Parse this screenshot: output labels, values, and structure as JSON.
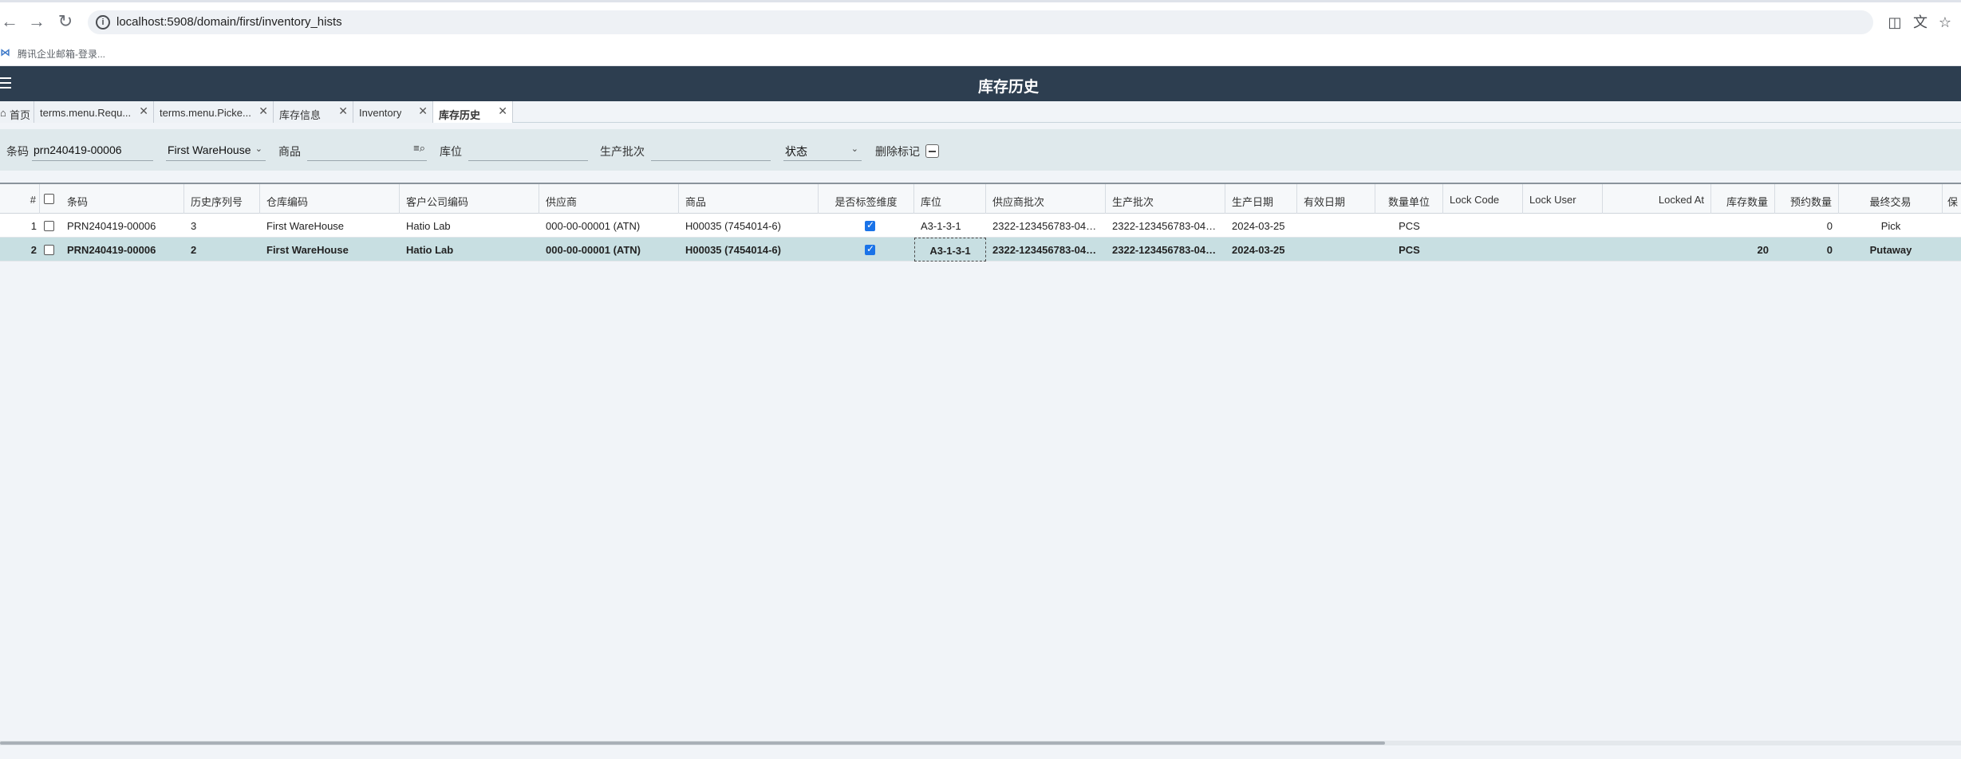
{
  "browser": {
    "url": "localhost:5908/domain/first/inventory_hists",
    "bookmark": "腾讯企业邮箱-登录..."
  },
  "app": {
    "title": "库存历史"
  },
  "tabs": [
    {
      "label": "首页",
      "icon": "home-icon"
    },
    {
      "label": "terms.menu.Requ..."
    },
    {
      "label": "terms.menu.Picke..."
    },
    {
      "label": "库存信息"
    },
    {
      "label": "Inventory"
    },
    {
      "label": "库存历史",
      "active": true
    }
  ],
  "filters": {
    "barcode_label": "条码",
    "barcode_value": "prn240419-00006",
    "warehouse_value": "First WareHouse",
    "product_label": "商品",
    "product_value": "",
    "location_label": "库位",
    "location_value": "",
    "batch_label": "生产批次",
    "batch_value": "",
    "status_label": "状态",
    "delete_flag_label": "删除标记"
  },
  "grid": {
    "columns": [
      "#",
      "条码",
      "历史序列号",
      "仓库编码",
      "客户公司编码",
      "供应商",
      "商品",
      "是否标签维度",
      "库位",
      "供应商批次",
      "生产批次",
      "生产日期",
      "有效日期",
      "数量单位",
      "Lock Code",
      "Lock User",
      "Locked At",
      "库存数量",
      "预约数量",
      "最终交易",
      "保"
    ],
    "rows": [
      {
        "no": "1",
        "barcode": "PRN240419-00006",
        "seq": "3",
        "warehouse": "First WareHouse",
        "company": "Hatio Lab",
        "supplier": "000-00-00001 (ATN)",
        "product": "H00035 (7454014-6)",
        "label_dim": true,
        "location": "A3-1-3-1",
        "supplier_batch": "2322-123456783-041...",
        "batch": "2322-123456783-041...",
        "mfg_date": "2024-03-25",
        "exp_date": "",
        "unit": "PCS",
        "lock_code": "",
        "lock_user": "",
        "locked_at": "",
        "qty": "",
        "reserved": "0",
        "last_tx": "Pick"
      },
      {
        "no": "2",
        "barcode": "PRN240419-00006",
        "seq": "2",
        "warehouse": "First WareHouse",
        "company": "Hatio Lab",
        "supplier": "000-00-00001 (ATN)",
        "product": "H00035 (7454014-6)",
        "label_dim": true,
        "location": "A3-1-3-1",
        "supplier_batch": "2322-123456783-041...",
        "batch": "2322-123456783-041...",
        "mfg_date": "2024-03-25",
        "exp_date": "",
        "unit": "PCS",
        "lock_code": "",
        "lock_user": "",
        "locked_at": "",
        "qty": "20",
        "reserved": "0",
        "last_tx": "Putaway"
      }
    ]
  }
}
